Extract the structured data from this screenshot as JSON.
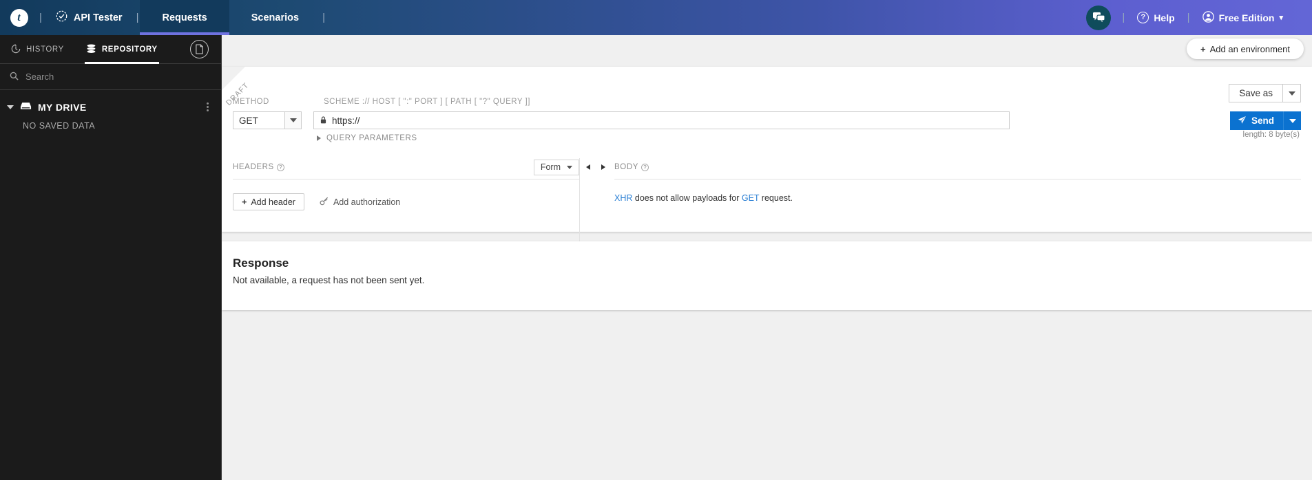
{
  "topbar": {
    "logo_letter": "t",
    "separator": "|",
    "app_name": "API Tester",
    "tabs": [
      {
        "label": "Requests",
        "active": true
      },
      {
        "label": "Scenarios",
        "active": false
      }
    ],
    "trailing_separator": "|",
    "chat_icon": "chat-bubbles-icon",
    "help_label": "Help",
    "help_icon": "question-circle-icon",
    "account_label": "Free Edition",
    "account_icon": "user-circle-icon",
    "account_caret": "▾"
  },
  "sidebar": {
    "tabs": [
      {
        "label": "HISTORY",
        "icon": "clock-history-icon",
        "active": false
      },
      {
        "label": "REPOSITORY",
        "icon": "database-icon",
        "active": true
      }
    ],
    "doc_button_icon": "document-icon",
    "search_placeholder": "Search",
    "search_value": "",
    "search_icon": "search-icon",
    "drive": {
      "label": "MY DRIVE",
      "icon": "drive-icon",
      "expanded": true,
      "empty_label": "NO SAVED DATA"
    }
  },
  "main": {
    "environment_button": "Add an environment",
    "environment_plus": "+",
    "request": {
      "draft_ribbon": "DRAFT",
      "method_label": "METHOD",
      "method_value": "GET",
      "url_label": "SCHEME :// HOST [ \":\" PORT ] [ PATH [ \"?\" QUERY ]]",
      "url_value": "https://",
      "url_lock_icon": "lock-icon",
      "save_as_label": "Save as",
      "send_label": "Send",
      "send_icon": "paper-plane-icon",
      "length_text": "length: 8 byte(s)",
      "query_parameters_label": "QUERY PARAMETERS",
      "headers_label": "HEADERS",
      "headers_help_icon": "help-icon",
      "form_select_value": "Form",
      "prev_arrow_icon": "chevron-left-icon",
      "next_arrow_icon": "chevron-right-icon",
      "body_label": "BODY",
      "body_help_icon": "help-icon",
      "add_header_label": "Add header",
      "add_header_plus": "+",
      "add_authorization_label": "Add authorization",
      "add_authorization_icon": "key-icon",
      "body_notice_prefix": "XHR",
      "body_notice_middle": " does not allow payloads for ",
      "body_notice_method": "GET",
      "body_notice_suffix": " request."
    },
    "response": {
      "title": "Response",
      "message": "Not available, a request has not been sent yet."
    }
  },
  "colors": {
    "accent_blue": "#0b72d0",
    "topbar_dark": "#123a5c",
    "topbar_purple": "#6366d6",
    "sidebar_bg": "#1b1b1b",
    "link_blue": "#2a7fd4"
  }
}
